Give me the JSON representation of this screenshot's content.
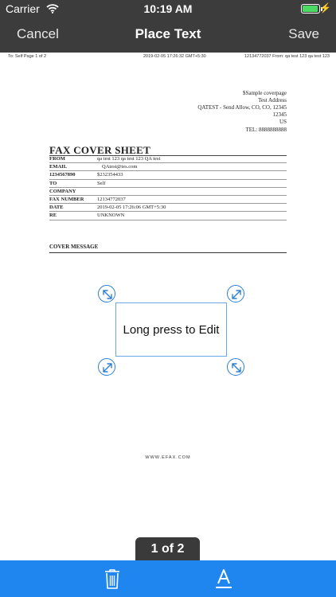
{
  "status_bar": {
    "carrier": "Carrier",
    "time": "10:19 AM",
    "battery_level": 0.95
  },
  "nav": {
    "cancel": "Cancel",
    "title": "Place Text",
    "save": "Save"
  },
  "document": {
    "fax_header": {
      "left": "To: Self     Page 1 of 2",
      "middle": "2019-02-05 17:26:32 GMT+5:30",
      "right": "12134772037   From: qa test 123 qa test 123"
    },
    "sender_lines": [
      "$Sample coverpage",
      "Test Address",
      "QATEST - Send Allow, CO, CO, 12345",
      "12345",
      "US"
    ],
    "tel": "TEL: 8888888888",
    "cover_title": "FAX COVER SHEET",
    "fields": [
      {
        "label": "FROM",
        "value": "qa test 123 qa test 123 QA test"
      },
      {
        "label": "EMAIL",
        "value": "QAtest@tes.com"
      },
      {
        "label": "1234567890",
        "value": "$232354433"
      },
      {
        "label": "TO",
        "value": "Self"
      },
      {
        "label": "COMPANY",
        "value": ""
      },
      {
        "label": "FAX NUMBER",
        "value": "12134772037"
      },
      {
        "label": "DATE",
        "value": "2019-02-05 17:26:06 GMT+5:30"
      },
      {
        "label": "RE",
        "value": "UNKNOWN"
      }
    ],
    "cover_message_label": "COVER MESSAGE",
    "footer": "WWW.EFAX.COM"
  },
  "text_box": {
    "text": "Long press to Edit"
  },
  "page_indicator": "1 of 2",
  "toolbar": {
    "delete_icon": "trash-icon",
    "format_icon": "text-format-icon"
  },
  "colors": {
    "nav_bg": "#3c3c3c",
    "toolbar_bg": "#1f86f0",
    "handle": "#2b7fd4",
    "battery": "#4cd964"
  }
}
